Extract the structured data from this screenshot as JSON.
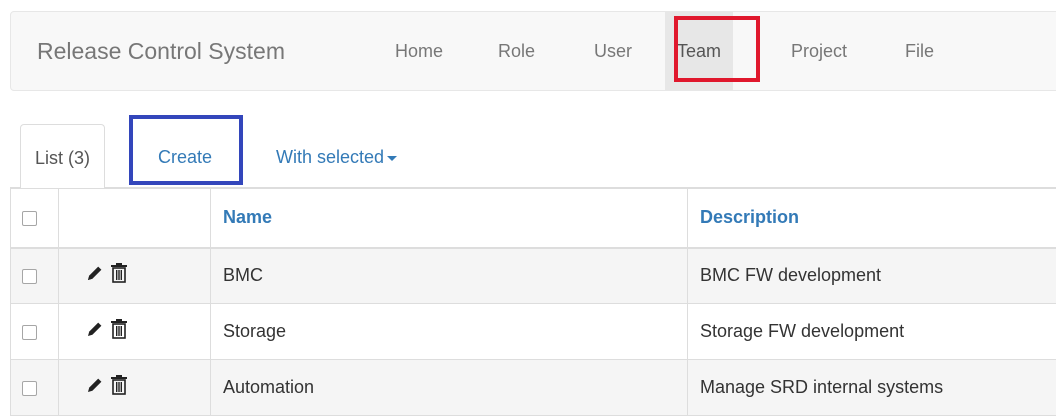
{
  "navbar": {
    "brand": "Release Control System",
    "items": [
      {
        "label": "Home"
      },
      {
        "label": "Role"
      },
      {
        "label": "User"
      },
      {
        "label": "Team"
      },
      {
        "label": "Project"
      },
      {
        "label": "File"
      }
    ],
    "active": "Team"
  },
  "tabs": {
    "list_label": "List (3)",
    "create_label": "Create",
    "with_selected_label": "With selected"
  },
  "table": {
    "headers": {
      "name": "Name",
      "description": "Description"
    },
    "rows": [
      {
        "name": "BMC",
        "description": "BMC FW development"
      },
      {
        "name": "Storage",
        "description": "Storage FW development"
      },
      {
        "name": "Automation",
        "description": "Manage SRD internal systems"
      }
    ]
  },
  "icons": {
    "edit": "pencil-icon",
    "delete": "trash-icon",
    "dropdown": "caret-down-icon"
  },
  "colors": {
    "link": "#337ab7",
    "highlight_red": "#e0182d",
    "highlight_blue": "#3346bb"
  }
}
